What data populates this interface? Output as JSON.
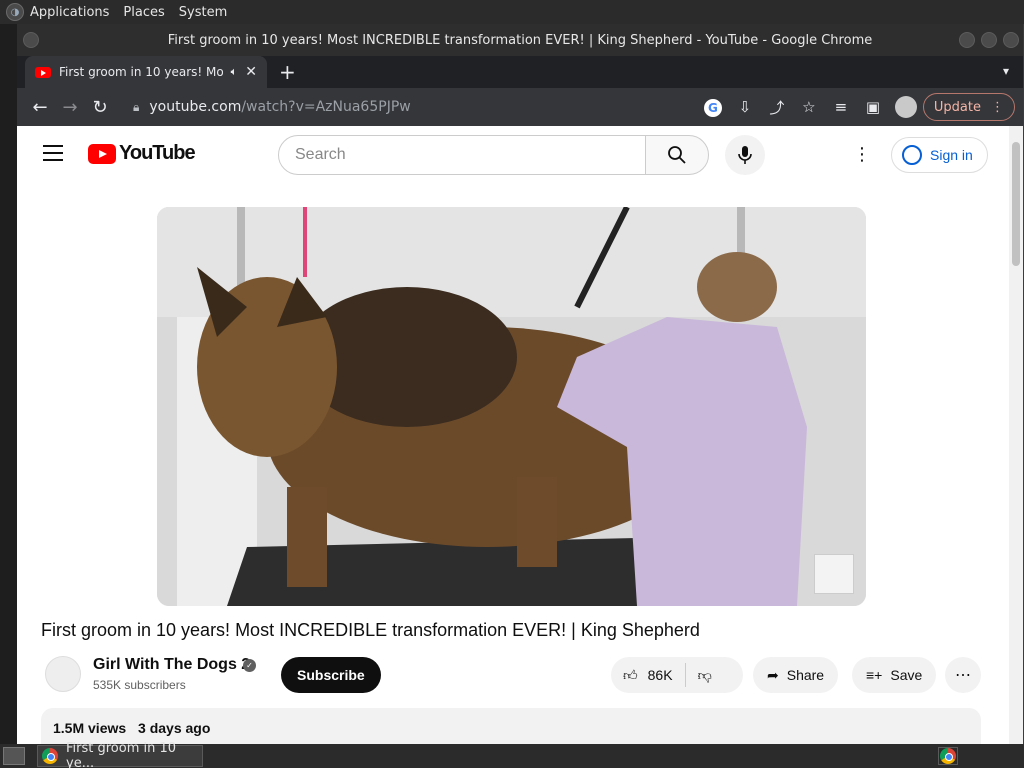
{
  "desktop": {
    "menus": [
      "Applications",
      "Places",
      "System"
    ]
  },
  "window": {
    "title": "First groom in 10 years! Most INCREDIBLE transformation EVER! | King Shepherd - YouTube - Google Chrome"
  },
  "tab": {
    "title": "First groom in 10 years! Mo",
    "audio_icon": "speaker-icon",
    "close_glyph": "✕",
    "new_tab_glyph": "+"
  },
  "toolbar": {
    "url_host": "youtube.com",
    "url_path": "/watch?v=AzNua65PJPw",
    "update_label": "Update"
  },
  "youtube": {
    "logo_text": "YouTube",
    "search_placeholder": "Search",
    "signin_label": "Sign in",
    "video": {
      "title": "First groom in 10 years! Most INCREDIBLE transformation EVER! | King Shepherd"
    },
    "channel": {
      "name": "Girl With The Dogs 2",
      "subscribers": "535K subscribers",
      "subscribe_label": "Subscribe"
    },
    "actions": {
      "likes": "86K",
      "share_label": "Share",
      "save_label": "Save"
    },
    "description": {
      "views": "1.5M views",
      "date": "3 days ago"
    }
  },
  "taskbar": {
    "task_label": "First groom in 10 ye..."
  },
  "colors": {
    "youtube_red": "#ff0000",
    "link_blue": "#065fd4",
    "chrome_dark": "#35363a"
  }
}
